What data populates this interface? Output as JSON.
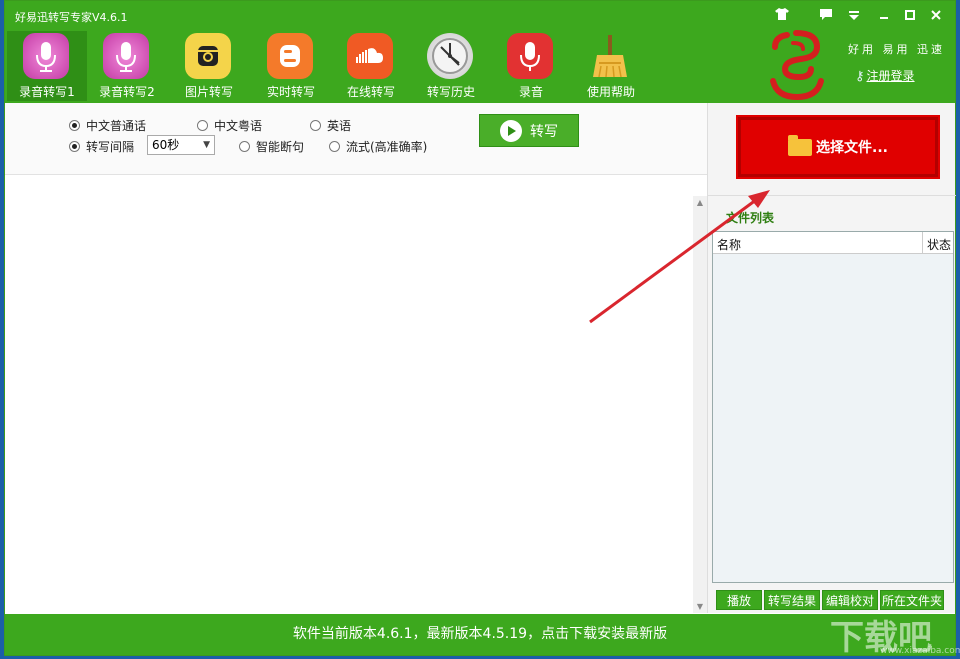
{
  "window": {
    "title": "好易迅转写专家V4.6.1",
    "controls": [
      "shirt-icon",
      "chat-icon",
      "dropdown-icon",
      "minimize-icon",
      "maximize-icon",
      "close-icon"
    ]
  },
  "colors": {
    "brand_green": "#3da81e",
    "dark_green": "#2f8f16",
    "accent_red": "#e00000",
    "arrow_red": "#d9262e"
  },
  "toolbar": {
    "items": [
      {
        "label": "录音转写1",
        "icon": "microphone-icon",
        "color": "#d946b6",
        "active": true
      },
      {
        "label": "录音转写2",
        "icon": "microphone-icon",
        "color": "#d946b6",
        "active": false
      },
      {
        "label": "图片转写",
        "icon": "camera-icon",
        "color": "#f4d44a",
        "active": false
      },
      {
        "label": "实时转写",
        "icon": "blogger-icon",
        "color": "#f47a2a",
        "active": false
      },
      {
        "label": "在线转写",
        "icon": "cloud-icon",
        "color": "#f05a24",
        "active": false
      },
      {
        "label": "转写历史",
        "icon": "clock-icon",
        "color": "#e8e8e8",
        "active": false
      },
      {
        "label": "录音",
        "icon": "mic-red-icon",
        "color": "#e23232",
        "active": false
      },
      {
        "label": "使用帮助",
        "icon": "broom-icon",
        "color": "#f2c14b",
        "active": false
      }
    ]
  },
  "brand": {
    "slogan": "好用 易用 迅速",
    "register_label": "注册登录"
  },
  "options": {
    "lang_mandarin": "中文普通话",
    "lang_cantonese": "中文粤语",
    "lang_english": "英语",
    "interval_label": "转写间隔",
    "interval_value": "60秒",
    "smart_break": "智能断句",
    "stream": "流式(高准确率)",
    "transcribe_button": "转写"
  },
  "right_panel": {
    "select_file_button": "选择文件...",
    "list_title": "文件列表",
    "columns": [
      "名称",
      "状态"
    ],
    "buttons": [
      "播放",
      "转写结果",
      "编辑校对",
      "所在文件夹"
    ]
  },
  "status_bar": {
    "text": "软件当前版本4.6.1，最新版本4.5.19，点击下载安装最新版"
  },
  "watermark": {
    "text": "下载吧",
    "url": "www.xiazaiba.com"
  }
}
